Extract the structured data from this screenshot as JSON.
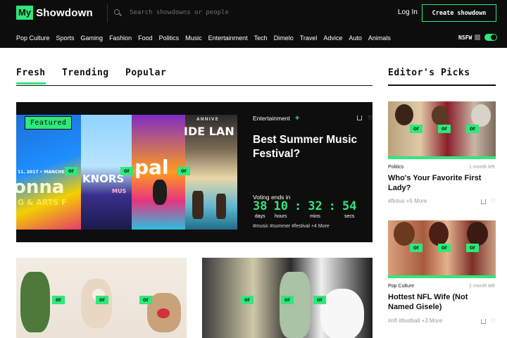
{
  "brand": {
    "my": "My",
    "name": "Showdown"
  },
  "search": {
    "placeholder": "Search showdowns or people"
  },
  "header": {
    "login": "Log In",
    "create": "Create showdown"
  },
  "nav": [
    "Pop Culture",
    "Sports",
    "Gaming",
    "Fashion",
    "Food",
    "Politics",
    "Music",
    "Entertainment",
    "Tech",
    "Dimelo",
    "Travel",
    "Advice",
    "Auto",
    "Animals"
  ],
  "nsfw": {
    "label": "NSFW",
    "enabled": true
  },
  "tabs": [
    "Fresh",
    "Trending",
    "Popular"
  ],
  "active_tab": "Fresh",
  "editors_picks_title": "Editor's Picks",
  "featured": {
    "tag": "Featured",
    "category": "Entertainment",
    "title": "Best Summer Music Festival?",
    "voting_label": "Voting ends in",
    "countdown": {
      "days": "38",
      "hours": "10",
      "mins": "32",
      "secs": "54"
    },
    "countdown_labels": {
      "days": "days",
      "hours": "hours",
      "mins": "mins",
      "secs": "secs"
    },
    "tags": "#music #summer #festival +4 More",
    "or_label": "or",
    "image_text": {
      "p1_date": "11, 2017 • MANCHE",
      "p1_big": "onna",
      "p1_sub": "G & ARTS F",
      "p2_big": "KNORS",
      "p2_sub": "MUS",
      "p3_big": "pal",
      "p4_top": "ANNIVE",
      "p4_big": "IDE LAN"
    }
  },
  "lower_cards": {
    "or_label": "or"
  },
  "editors_picks": [
    {
      "category": "Politics",
      "time": "1 month left",
      "title": "Who's Your Favorite First Lady?",
      "tags": "#flotus +5 More"
    },
    {
      "category": "Pop Culture",
      "time": "1 month left",
      "title": "Hottest NFL Wife (Not Named Gisele)",
      "tags": "#nfl #football +3 More"
    }
  ],
  "colors": {
    "accent": "#2ee87a",
    "header_bg": "#0d0d0d"
  }
}
